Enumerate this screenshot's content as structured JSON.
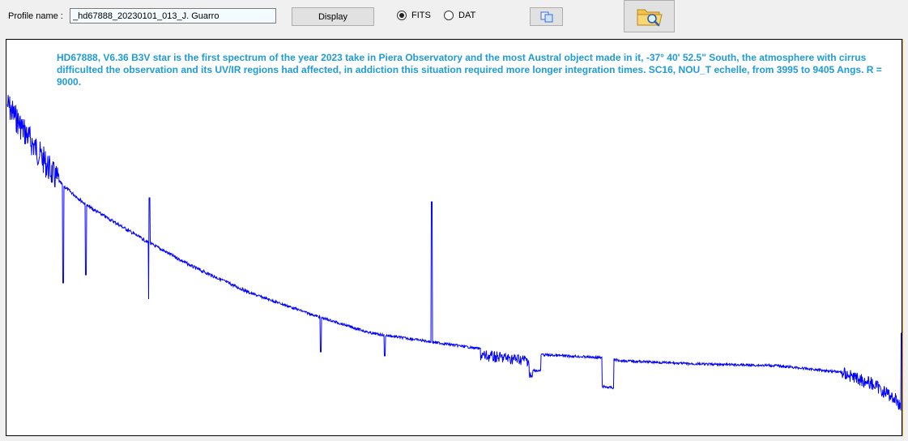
{
  "toolbar": {
    "profile_label": "Profile name :",
    "profile_value": "_hd67888_20230101_013_J. Guarro",
    "display_label": "Display",
    "format_options": [
      {
        "label": "FITS",
        "selected": true
      },
      {
        "label": "DAT",
        "selected": false
      }
    ],
    "copy_icon": "copy-icon",
    "open_icon": "folder-search-icon"
  },
  "plot": {
    "annotation": "HD67888, V6.36 B3V star is the first spectrum of the year 2023 take in Piera Observatory and the most Austral object made in it, -37° 40' 52.5\" South, the atmosphere with cirrus difficulted the observation and its  UV/IR regions had affected, in addiction this situation required more longer integration times. SC16, NOU_T echelle, from 3995 to 9405 Angs. R = 9000.",
    "line_color": "#0000ff",
    "annotation_color": "#1f9bd8"
  }
}
